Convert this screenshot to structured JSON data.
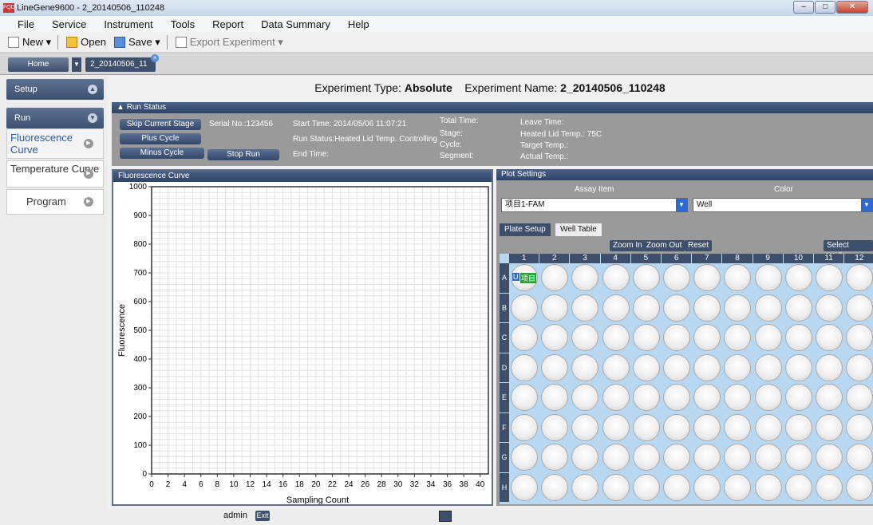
{
  "window": {
    "title": "LineGene9600 - 2_20140506_110248",
    "logo": "FQD"
  },
  "menu": [
    "File",
    "Service",
    "Instrument",
    "Tools",
    "Report",
    "Data Summary",
    "Help"
  ],
  "toolbar": {
    "new": "New",
    "open": "Open",
    "save": "Save",
    "export": "Export Experiment"
  },
  "tabs": {
    "home": "Home",
    "doc": "2_20140506_11"
  },
  "sidebar": {
    "setup": "Setup",
    "run": "Run",
    "items": [
      "Fluorescence Curve",
      "Temperature Curve",
      "Program"
    ]
  },
  "experiment": {
    "type_label": "Experiment Type:",
    "type": "Absolute",
    "name_label": "Experiment Name:",
    "name": "2_20140506_110248"
  },
  "run_status": {
    "title": "Run Status",
    "buttons": {
      "skip": "Skip Current Stage",
      "plus": "Plus Cycle",
      "minus": "Minus Cycle",
      "stop": "Stop Run"
    },
    "serial": "Serial No.:123456",
    "start_time": "Start Time: 2014/05/06 11:07:21",
    "run_status": "Run Status:Heated Lid Temp. Controlling",
    "end_time": "End Time:",
    "total_time": "Total Time:",
    "stage": "Stage:",
    "cycle": "Cycle:",
    "segment": "Segment:",
    "leave_time": "Leave Time:",
    "heated_lid": "Heated Lid Temp.: 75C",
    "target_temp": "Target Temp.:",
    "actual_temp": "Actual Temp.:"
  },
  "fluor_panel": {
    "title": "Fluorescence Curve"
  },
  "chart_data": {
    "type": "line",
    "series": [],
    "xlabel": "Sampling Count",
    "ylabel": "Fluorescence",
    "xlim": [
      0,
      41
    ],
    "ylim": [
      0,
      1000
    ],
    "xticks": [
      "0",
      "2",
      "4",
      "6",
      "8",
      "10",
      "12",
      "14",
      "16",
      "18",
      "20",
      "22",
      "24",
      "26",
      "28",
      "30",
      "32",
      "34",
      "36",
      "38",
      "40"
    ],
    "yticks": [
      "0",
      "100",
      "200",
      "300",
      "400",
      "500",
      "600",
      "700",
      "800",
      "900",
      "1000"
    ],
    "grid": true
  },
  "plot_settings": {
    "title": "Plot Settings",
    "assay_label": "Assay Item",
    "color_label": "Color",
    "assay_value": "项目1-FAM",
    "color_value": "Well"
  },
  "plate": {
    "tabs": [
      "Plate Setup",
      "Well Table"
    ],
    "zoom_in": "Zoom In",
    "zoom_out": "Zoom Out",
    "reset": "Reset",
    "select_wells": "Select Wells ▼",
    "columns": [
      "1",
      "2",
      "3",
      "4",
      "5",
      "6",
      "7",
      "8",
      "9",
      "10",
      "11",
      "12"
    ],
    "rows": [
      "A",
      "B",
      "C",
      "D",
      "E",
      "F",
      "G",
      "H"
    ],
    "well_a1": {
      "tag": "U",
      "label": "项目"
    }
  },
  "status": {
    "user": "admin",
    "exit": "Exit"
  }
}
